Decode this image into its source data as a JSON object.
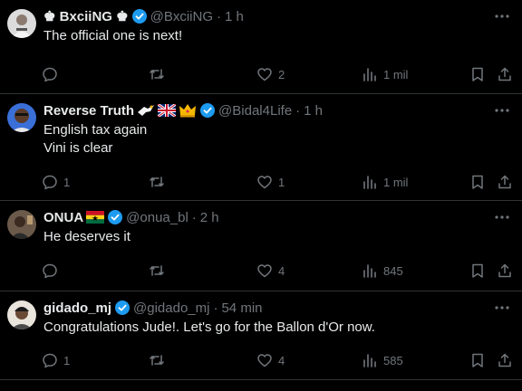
{
  "tweets": [
    {
      "display_name": "♚ BxciiNG ♚",
      "handle": "@BxciiNG",
      "time": "1 h",
      "lines": [
        "The official one is next!"
      ],
      "replies": "",
      "retweets": "",
      "likes": "2",
      "views": "1 mil",
      "verified": true
    },
    {
      "display_name": "Reverse Truth",
      "emoji": [
        "eagle",
        "union-jack-flag",
        "crown"
      ],
      "handle": "@Bidal4Life",
      "time": "1 h",
      "lines": [
        "English tax again",
        "Vini is clear"
      ],
      "replies": "1",
      "retweets": "",
      "likes": "1",
      "views": "1 mil",
      "verified": true
    },
    {
      "display_name": "ONUA",
      "emoji": [
        "ghana-flag"
      ],
      "handle": "@onua_bl",
      "time": "2 h",
      "lines": [
        "He deserves it"
      ],
      "replies": "",
      "retweets": "",
      "likes": "4",
      "views": "845",
      "verified": true
    },
    {
      "display_name": "gidado_mj",
      "handle": "@gidado_mj",
      "time": "54 min",
      "lines": [
        "Congratulations Jude!. Let's go for the Ballon d'Or now."
      ],
      "replies": "1",
      "retweets": "",
      "likes": "4",
      "views": "585",
      "verified": true
    }
  ],
  "separator": "·",
  "colors": {
    "background": "#000000",
    "text": "#e7e9ea",
    "muted": "#71767b",
    "border": "#2f3336",
    "verified": "#1d9bf0"
  }
}
